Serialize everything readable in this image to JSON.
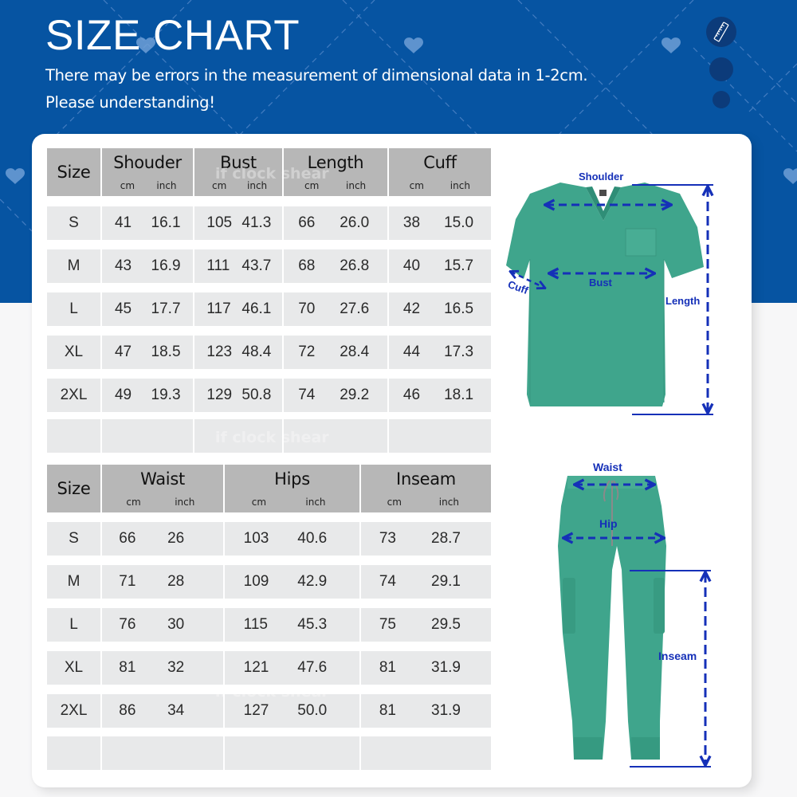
{
  "header": {
    "title": "SIZE CHART",
    "subtitle_line1": "There may be errors in the measurement of dimensional data in 1-2cm.",
    "subtitle_line2": "Please understanding!",
    "decor_icon": "ruler-icon"
  },
  "colors": {
    "banner_blue": "#0654a2",
    "header_cell_gray": "#b7b7b7",
    "data_cell_gray": "#e8e9ea",
    "garment_teal": "#3fa58c",
    "measure_arrow_blue": "#1530b8"
  },
  "watermark": "if clock shear",
  "top_table": {
    "size_header": "Size",
    "unit_cm": "cm",
    "unit_inch": "inch",
    "columns": [
      "Shouder",
      "Bust",
      "Length",
      "Cuff"
    ],
    "rows": [
      {
        "size": "S",
        "values": [
          [
            "41",
            "16.1"
          ],
          [
            "105",
            "41.3"
          ],
          [
            "66",
            "26.0"
          ],
          [
            "38",
            "15.0"
          ]
        ]
      },
      {
        "size": "M",
        "values": [
          [
            "43",
            "16.9"
          ],
          [
            "111",
            "43.7"
          ],
          [
            "68",
            "26.8"
          ],
          [
            "40",
            "15.7"
          ]
        ]
      },
      {
        "size": "L",
        "values": [
          [
            "45",
            "17.7"
          ],
          [
            "117",
            "46.1"
          ],
          [
            "70",
            "27.6"
          ],
          [
            "42",
            "16.5"
          ]
        ]
      },
      {
        "size": "XL",
        "values": [
          [
            "47",
            "18.5"
          ],
          [
            "123",
            "48.4"
          ],
          [
            "72",
            "28.4"
          ],
          [
            "44",
            "17.3"
          ]
        ]
      },
      {
        "size": "2XL",
        "values": [
          [
            "49",
            "19.3"
          ],
          [
            "129",
            "50.8"
          ],
          [
            "74",
            "29.2"
          ],
          [
            "46",
            "18.1"
          ]
        ]
      },
      {
        "size": "",
        "values": [
          [
            "",
            ""
          ],
          [
            "",
            ""
          ],
          [
            "",
            ""
          ],
          [
            "",
            ""
          ]
        ]
      }
    ]
  },
  "bottom_table": {
    "size_header": "Size",
    "unit_cm": "cm",
    "unit_inch": "inch",
    "columns": [
      "Waist",
      "Hips",
      "Inseam"
    ],
    "rows": [
      {
        "size": "S",
        "values": [
          [
            "66",
            "26"
          ],
          [
            "103",
            "40.6"
          ],
          [
            "73",
            "28.7"
          ]
        ]
      },
      {
        "size": "M",
        "values": [
          [
            "71",
            "28"
          ],
          [
            "109",
            "42.9"
          ],
          [
            "74",
            "29.1"
          ]
        ]
      },
      {
        "size": "L",
        "values": [
          [
            "76",
            "30"
          ],
          [
            "115",
            "45.3"
          ],
          [
            "75",
            "29.5"
          ]
        ]
      },
      {
        "size": "XL",
        "values": [
          [
            "81",
            "32"
          ],
          [
            "121",
            "47.6"
          ],
          [
            "81",
            "31.9"
          ]
        ]
      },
      {
        "size": "2XL",
        "values": [
          [
            "86",
            "34"
          ],
          [
            "127",
            "50.0"
          ],
          [
            "81",
            "31.9"
          ]
        ]
      },
      {
        "size": "",
        "values": [
          [
            "",
            ""
          ],
          [
            "",
            ""
          ],
          [
            "",
            ""
          ]
        ]
      }
    ]
  },
  "shirt_diagram": {
    "labels": {
      "shoulder": "Shoulder",
      "bust": "Bust",
      "cuff": "Cuff",
      "length": "Length"
    }
  },
  "pants_diagram": {
    "labels": {
      "waist": "Waist",
      "hip": "Hip",
      "inseam": "Inseam"
    }
  }
}
